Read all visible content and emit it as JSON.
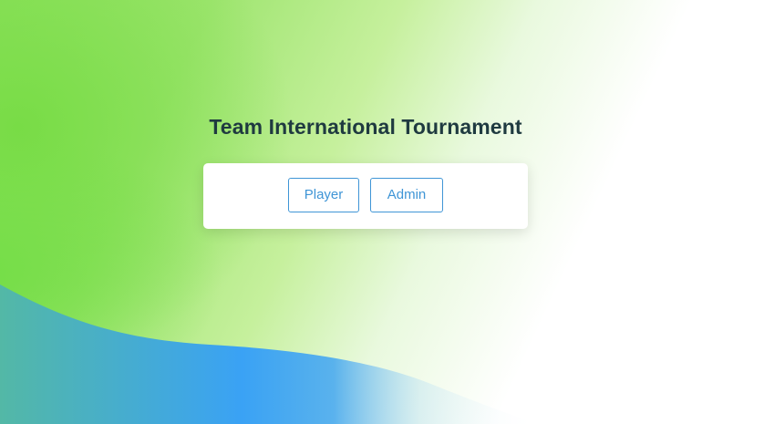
{
  "page": {
    "title": "Team International Tournament"
  },
  "login_options": {
    "player_label": "Player",
    "admin_label": "Admin"
  },
  "colors": {
    "accent": "#3f95d6",
    "title": "#1f3a40",
    "green": "#7fe04e",
    "blue": "#3aa2f5"
  }
}
